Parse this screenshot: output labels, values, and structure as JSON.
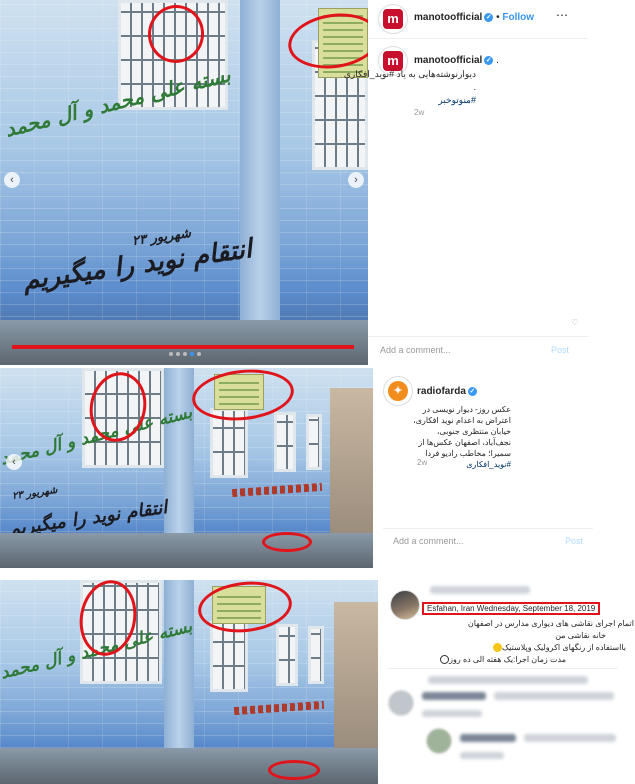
{
  "panel1": {
    "account": "manotoofficial",
    "follow_label": "Follow",
    "more_icon": "more-options-icon",
    "caption_user": "manotoofficial",
    "caption_suffix": ".",
    "caption_line1": "دیوارنوشته‌هایی به یاد #نوید_افکاری",
    "caption_line2": ".",
    "caption_hashtag": "#منوتوخبر",
    "time": "2w",
    "add_comment_placeholder": "Add a comment...",
    "post_label": "Post",
    "graffiti_green": "بسته علی محمد و آل محمد",
    "graffiti_black": "انتقام نوید را میگیریم",
    "graffiti_date": "۲۳ شهریور",
    "carousel_dots": 5,
    "carousel_active": 3
  },
  "panel2": {
    "account": "radiofarda",
    "caption": "عکس روز- دیوار نویسی در اعتراض به اعدام نوید افکاری، خیابان منتظری جنوبی، نجف‌آباد، اصفهان عکس‌ها از سمیرا؛ مخاطب رادیو فردا",
    "caption_hashtag": "#نوید_افکاری",
    "time": "2w",
    "add_comment_placeholder": "Add a comment...",
    "post_label": "Post",
    "graffiti_green": "بسته علی محمد و آل محمد",
    "graffiti_black": "انتقام نوید را میگیریم",
    "graffiti_date": "۲۳ شهریور"
  },
  "panel3": {
    "metadata": "Esfahan, Iran  Wednesday, September 18, 2019",
    "line1": "اتمام اجرای نقاشی های دیواری مدارس در اصفهان",
    "line2": "خانه نقاشی من",
    "line3": "بااستفاده از رنگهای اکرولیک وپلاستیک",
    "line4": "مدت زمان اجرا:یک هفته الی ده روز",
    "graffiti_green": "بسته علی محمد و آل محمد"
  },
  "colors": {
    "annotation_red": "#e0141a",
    "instagram_blue": "#3897f0",
    "manoto_red": "#c8102e",
    "radiofarda_orange": "#f28c1c"
  }
}
